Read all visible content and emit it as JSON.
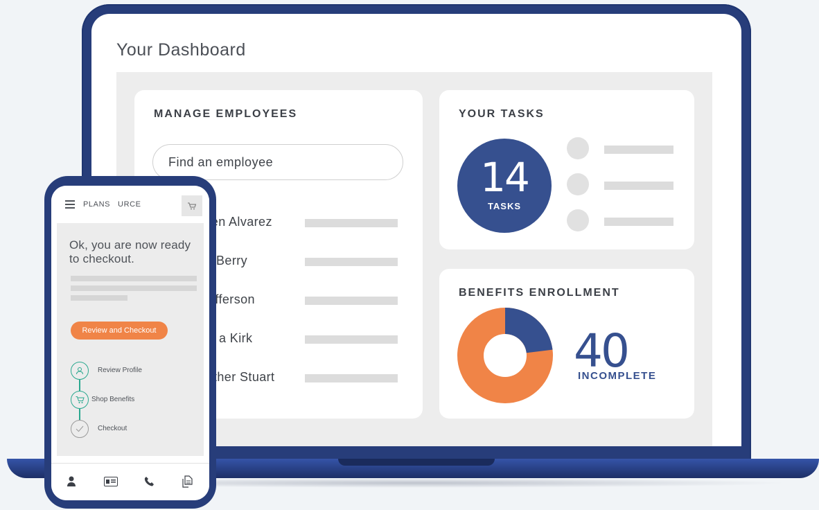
{
  "dashboard": {
    "title": "Your Dashboard",
    "manage_employees": {
      "title": "MANAGE EMPLOYEES",
      "search_placeholder": "Find an employee",
      "employees": [
        "Kristen Alvarez",
        "Ann Berry",
        "Jill Jefferson",
        "Maria Kirk",
        "Heather Stuart"
      ],
      "employees_visible": [
        "sten Alvarez",
        "Berry",
        "efferson",
        "a Kirk",
        "ther Stuart"
      ]
    },
    "tasks": {
      "title": "YOUR TASKS",
      "count": "14",
      "count_label": "TASKS"
    },
    "benefits": {
      "title": "BENEFITS ENROLLMENT",
      "value": "40",
      "value_label": "INCOMPLETE",
      "complete_fraction": 0.23
    }
  },
  "phone": {
    "brand": "PLANS   URCE",
    "message": "Ok, you are now ready to checkout.",
    "button_label": "Review and Checkout",
    "steps": [
      {
        "label": "Review Profile",
        "icon": "user-icon"
      },
      {
        "label": "Shop Benefits",
        "icon": "cart-icon"
      },
      {
        "label": "Checkout",
        "icon": "check-icon"
      }
    ],
    "footer_icons": [
      "person-icon",
      "id-card-icon",
      "phone-icon",
      "documents-icon"
    ]
  },
  "colors": {
    "navy": "#36508f",
    "orange": "#f08447",
    "teal": "#2aa88f",
    "device": "#273d7a"
  }
}
